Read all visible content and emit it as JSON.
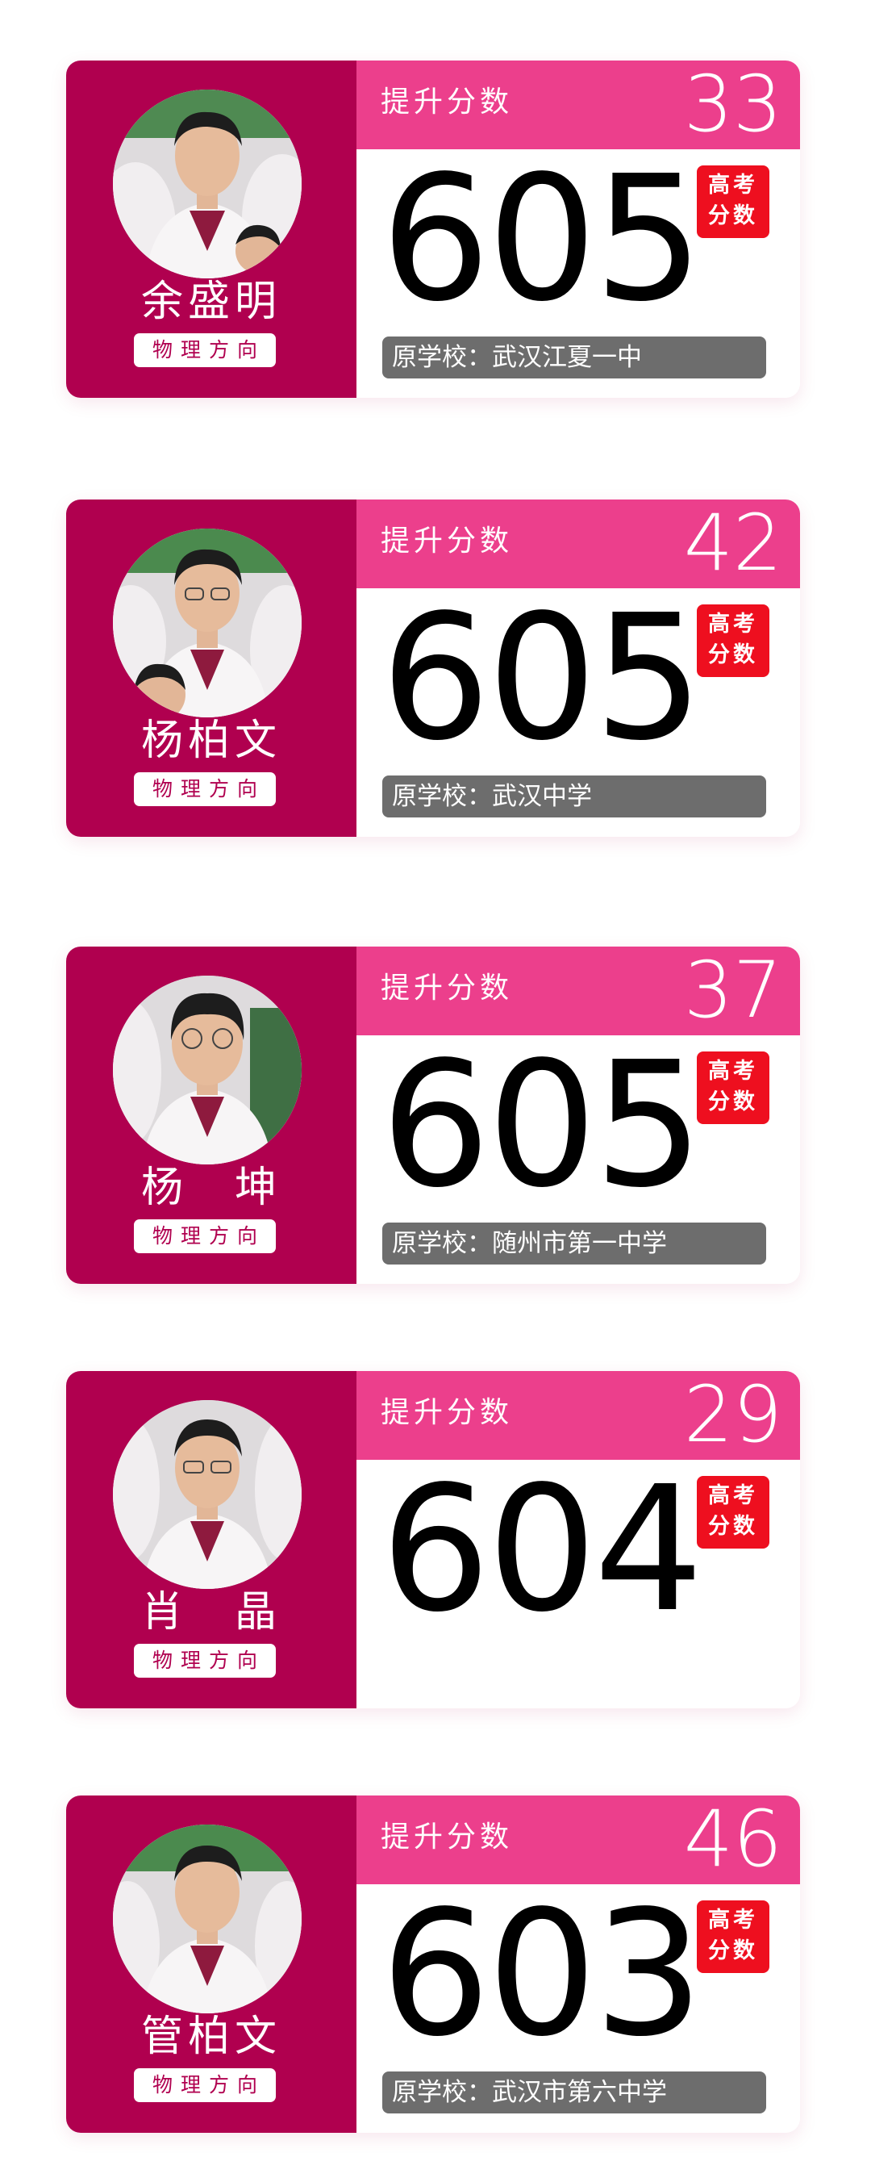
{
  "students": [
    {
      "name": "余盛明",
      "direction": "物理方向",
      "increase_label": "提升分数",
      "increase": "33",
      "score": "605",
      "exam_badge_line1": "高考",
      "exam_badge_line2": "分数",
      "school": "原学校：武汉江夏一中"
    },
    {
      "name": "杨柏文",
      "direction": "物理方向",
      "increase_label": "提升分数",
      "increase": "42",
      "score": "605",
      "exam_badge_line1": "高考",
      "exam_badge_line2": "分数",
      "school": "原学校：武汉中学"
    },
    {
      "name": "杨　坤",
      "direction": "物理方向",
      "increase_label": "提升分数",
      "increase": "37",
      "score": "605",
      "exam_badge_line1": "高考",
      "exam_badge_line2": "分数",
      "school": "原学校：随州市第一中学"
    },
    {
      "name": "肖　晶",
      "direction": "物理方向",
      "increase_label": "提升分数",
      "increase": "29",
      "score": "604",
      "exam_badge_line1": "高考",
      "exam_badge_line2": "分数",
      "school": ""
    },
    {
      "name": "管柏文",
      "direction": "物理方向",
      "increase_label": "提升分数",
      "increase": "46",
      "score": "603",
      "exam_badge_line1": "高考",
      "exam_badge_line2": "分数",
      "school": "原学校：武汉市第六中学"
    }
  ],
  "colors": {
    "card_left": "#b0004f",
    "header_band": "#ec3f8c",
    "exam_badge": "#ee0f1f",
    "school_bar": "#6d6d6d"
  },
  "icons": {
    "avatar": "student-photo"
  }
}
